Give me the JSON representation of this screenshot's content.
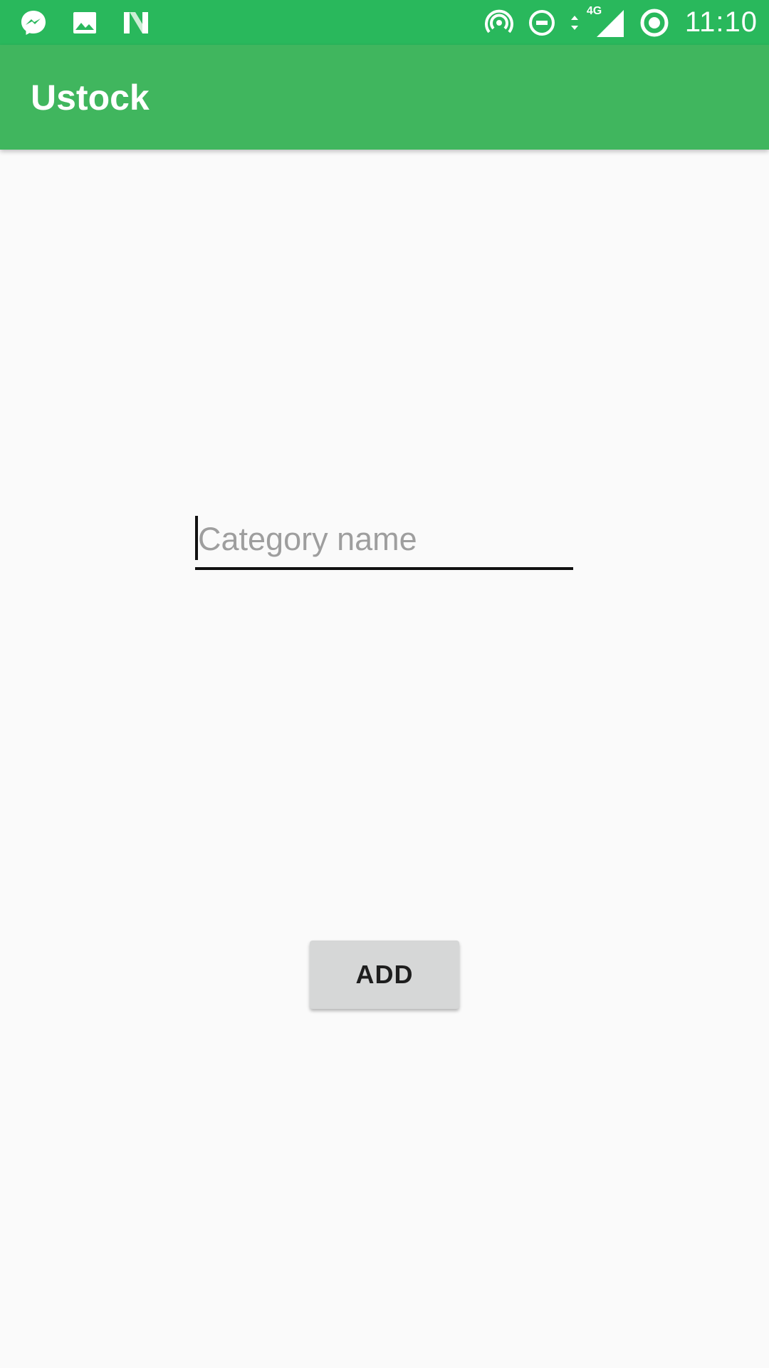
{
  "status_bar": {
    "time": "11:10",
    "network_label": "4G",
    "left_icons": [
      "messenger-icon",
      "gallery-icon",
      "n-app-icon"
    ],
    "right_icons": [
      "hotspot-icon",
      "do-not-disturb-icon",
      "data-arrows-icon",
      "signal-icon",
      "sync-icon"
    ]
  },
  "app_bar": {
    "title": "Ustock"
  },
  "form": {
    "category_placeholder": "Category name",
    "category_value": ""
  },
  "actions": {
    "add_label": "ADD"
  },
  "colors": {
    "status_bar": "#29b85c",
    "app_bar": "#40b65e",
    "background": "#fafafa",
    "button": "#d6d7d7"
  }
}
